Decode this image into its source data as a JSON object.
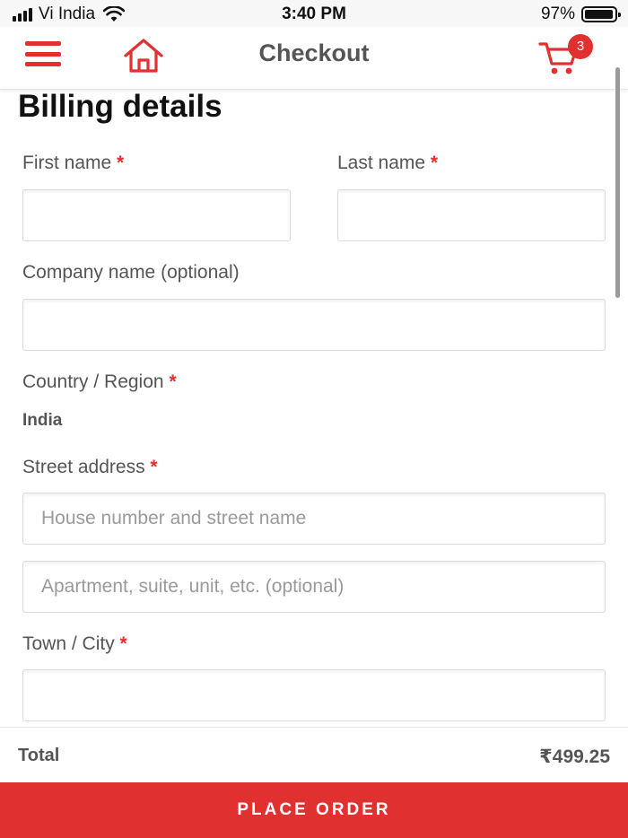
{
  "status_bar": {
    "carrier": "Vi India",
    "time": "3:40 PM",
    "battery_text": "97%",
    "battery_level": 0.97
  },
  "header": {
    "title": "Checkout",
    "cart_count": "3"
  },
  "form": {
    "title": "Billing details",
    "first_name_label": "First name",
    "last_name_label": "Last name",
    "company_label": "Company name (optional)",
    "country_label": "Country / Region",
    "country_value": "India",
    "street_label": "Street address",
    "street_placeholder_1": "House number and street name",
    "street_placeholder_2": "Apartment, suite, unit, etc. (optional)",
    "city_label": "Town / City",
    "required_mark": "*"
  },
  "footer": {
    "total_label": "Total",
    "total_value": "₹499.25",
    "place_order_label": "PLACE ORDER"
  },
  "colors": {
    "accent": "#e0302f",
    "label": "#555555",
    "title": "#111111"
  }
}
